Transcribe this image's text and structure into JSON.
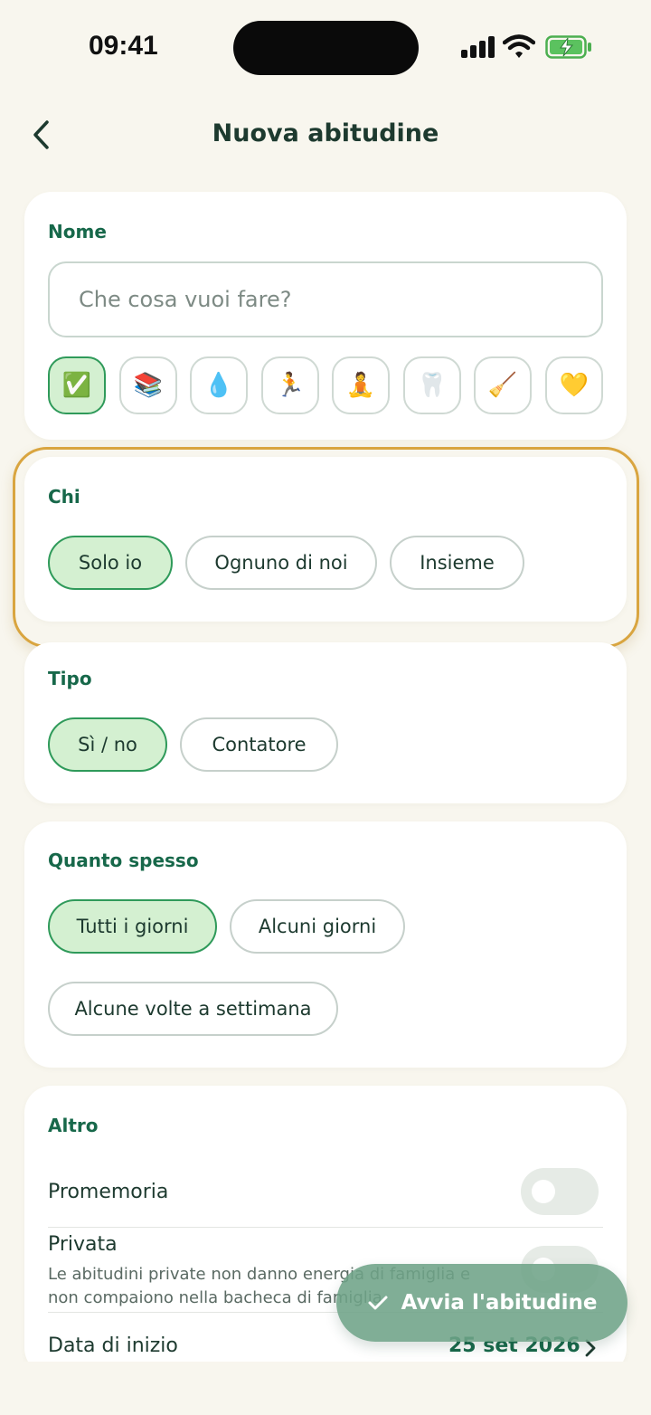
{
  "status_bar": {
    "time": "09:41"
  },
  "header": {
    "title": "Nuova abitudine"
  },
  "name_card": {
    "label": "Nome",
    "input_placeholder": "Che cosa vuoi fare?",
    "input_value": "",
    "emojis": [
      "✅",
      "📚",
      "💧",
      "🏃",
      "🧘",
      "🦷",
      "🧹",
      "💛"
    ],
    "selected_emoji_index": 0
  },
  "who_card": {
    "label": "Chi",
    "options": [
      "Solo io",
      "Ognuno di noi",
      "Insieme"
    ],
    "selected": "Solo io"
  },
  "type_card": {
    "label": "Tipo",
    "options": [
      "Sì / no",
      "Contatore"
    ],
    "selected": "Sì / no"
  },
  "frequency_card": {
    "label": "Quanto spesso",
    "options": [
      "Tutti i giorni",
      "Alcuni giorni",
      "Alcune volte a settimana"
    ],
    "selected": "Tutti i giorni"
  },
  "other_card": {
    "label": "Altro",
    "reminder_label": "Promemoria",
    "reminder_on": false,
    "private_label": "Privata",
    "private_help": "Le abitudini private non danno energia di famiglia e non compaiono nella bacheca di famiglia",
    "private_on": false,
    "start_date_label": "Data di inizio",
    "start_date_value": "25 set 2026"
  },
  "fab": {
    "label": "Avvia l'abitudine"
  },
  "colors": {
    "background": "#f8f6ee",
    "accent_green": "#17684a",
    "chip_active": "#d4f0d1",
    "highlight_ring": "#d9a540"
  }
}
